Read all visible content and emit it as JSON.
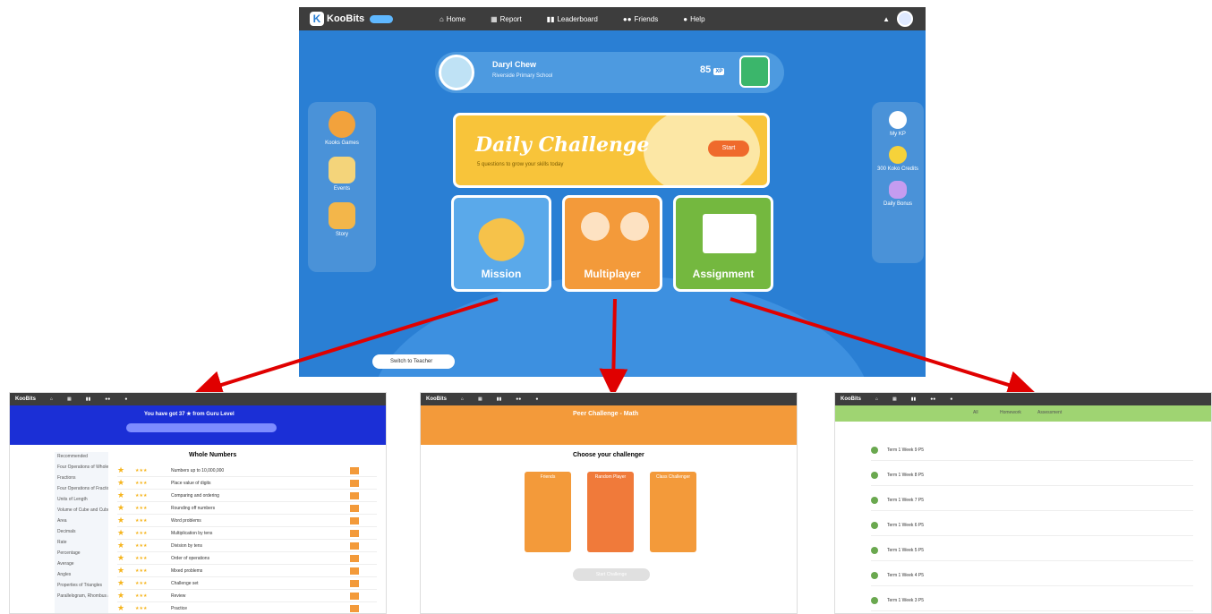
{
  "main": {
    "logo": "KooBits",
    "nav": [
      "Home",
      "Report",
      "Leaderboard",
      "Friends",
      "Help"
    ],
    "profile": {
      "name": "Daryl Chew",
      "school": "Riverside Primary School",
      "xp": "85",
      "xp_unit": "XP"
    },
    "left_panel": [
      {
        "label": "Kooks Games"
      },
      {
        "label": "Events"
      },
      {
        "label": "Story"
      }
    ],
    "right_panel": [
      {
        "label": "My KP"
      },
      {
        "label": "300 Koko Credits"
      },
      {
        "label": "Daily Bonus"
      }
    ],
    "daily": {
      "title": "Daily Challenge",
      "subtitle": "5 questions to grow your skills today",
      "start": "Start"
    },
    "cards": [
      {
        "label": "Mission",
        "color": "#5aa9ea"
      },
      {
        "label": "Multiplayer",
        "color": "#f39a3a"
      },
      {
        "label": "Assignment",
        "color": "#74b83f"
      }
    ],
    "switch": "Switch to Teacher"
  },
  "mission": {
    "banner": "You have got 37 ★ from Guru Level",
    "title": "Whole Numbers",
    "topics": [
      "Recommended",
      "Four Operations of Whole Numbers",
      "Fractions",
      "Four Operations of Fractions",
      "Units of Length",
      "Volume of Cube and Cuboid",
      "Area",
      "Decimals",
      "Rate",
      "Percentage",
      "Average",
      "Angles",
      "Properties of Triangles",
      "Parallelogram, Rhombus and Trapezium"
    ],
    "lessons": [
      "Numbers up to 10,000,000",
      "Place value of digits",
      "Comparing and ordering",
      "Rounding off numbers",
      "Word problems",
      "Multiplication by tens",
      "Division by tens",
      "Order of operations",
      "Mixed problems",
      "Challenge set",
      "Review",
      "Practice"
    ]
  },
  "multiplayer": {
    "title": "Peer Challenge - Math",
    "choose": "Choose your challenger",
    "options": [
      "Friends",
      "Random Player",
      "Class Challenger"
    ],
    "start": "Start Challenge"
  },
  "assignment": {
    "tabs": [
      "All",
      "Homework",
      "Assessment"
    ],
    "items": [
      "Term 1 Week 9 P5",
      "Term 1 Week 8 P5",
      "Term 1 Week 7 P5",
      "Term 1 Week 6 P5",
      "Term 1 Week 5 P5",
      "Term 1 Week 4 P5",
      "Term 1 Week 3 P5"
    ]
  },
  "colors": {
    "arrow": "#e00000",
    "main_bg": "#2a7fd4",
    "mission_banner": "#1b2fd6",
    "multi_header": "#f39a3a",
    "assign_header": "#9fd472"
  }
}
